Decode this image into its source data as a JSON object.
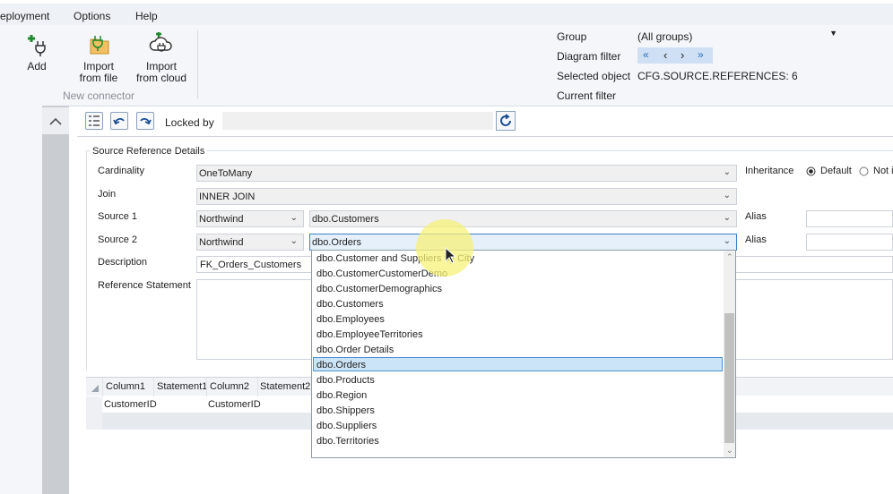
{
  "menu": [
    "eployment",
    "Options",
    "Help"
  ],
  "ribbon": {
    "buttons": [
      {
        "label": "Add",
        "icon": "add-plug-icon"
      },
      {
        "label": "Import\nfrom file",
        "icon": "import-file-icon"
      },
      {
        "label": "Import\nfrom cloud",
        "icon": "import-cloud-icon"
      }
    ],
    "group_label": "New connector"
  },
  "props": {
    "group_label": "Group",
    "group_value": "(All groups)",
    "diagram_filter_label": "Diagram filter",
    "diagram_filter_buttons": [
      "«",
      "‹",
      "›",
      "»"
    ],
    "selected_object_label": "Selected object",
    "selected_object_value": "CFG.SOURCE.REFERENCES: 6",
    "current_filter_label": "Current filter"
  },
  "toolbar": {
    "locked_by_label": "Locked by",
    "locked_by_value": ""
  },
  "form": {
    "section_title": "Source Reference Details",
    "cardinality_label": "Cardinality",
    "cardinality_value": "OneToMany",
    "inheritance_label": "Inheritance",
    "inheritance_default": "Default",
    "inheritance_not": "Not i",
    "join_label": "Join",
    "join_value": "INNER JOIN",
    "source1_label": "Source 1",
    "source1_db": "Northwind",
    "source1_table": "dbo.Customers",
    "alias1_label": "Alias",
    "alias1_value": "",
    "source2_label": "Source 2",
    "source2_db": "Northwind",
    "source2_table": "dbo.Orders",
    "alias2_label": "Alias",
    "alias2_value": "",
    "description_label": "Description",
    "description_value": "FK_Orders_Customers",
    "reference_statement_label": "Reference Statement"
  },
  "dropdown": {
    "items": [
      "dbo.Customer and Suppliers by City",
      "dbo.CustomerCustomerDemo",
      "dbo.CustomerDemographics",
      "dbo.Customers",
      "dbo.Employees",
      "dbo.EmployeeTerritories",
      "dbo.Order Details",
      "dbo.Orders",
      "dbo.Products",
      "dbo.Region",
      "dbo.Shippers",
      "dbo.Suppliers",
      "dbo.Territories"
    ],
    "selected": "dbo.Orders"
  },
  "grid": {
    "columns": [
      "Column1",
      "Statement1",
      "Column2",
      "Statement2"
    ],
    "rows": [
      [
        "CustomerID",
        "",
        "CustomerID",
        ""
      ]
    ]
  },
  "colors": {
    "accent": "#2b6cb8",
    "selection": "#cce4f7",
    "highlight": "#f6f27a"
  }
}
